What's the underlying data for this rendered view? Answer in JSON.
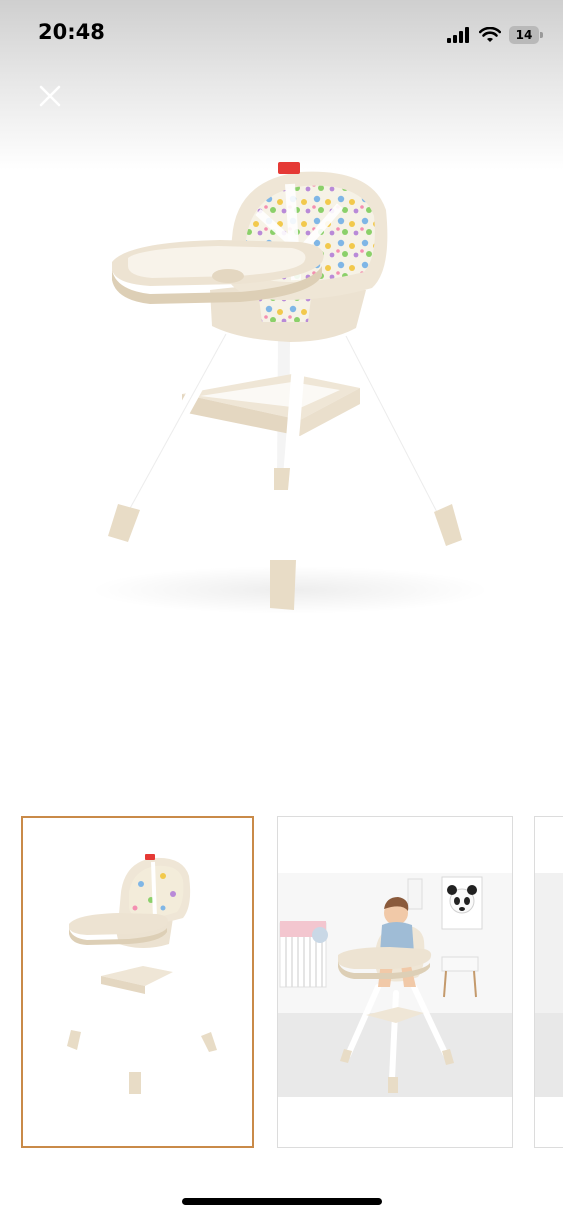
{
  "status_bar": {
    "time": "20:48",
    "battery_level": "14",
    "icons": [
      "cellular-signal-icon",
      "wifi-icon",
      "battery-charging-icon"
    ]
  },
  "viewer": {
    "close_icon": "close-icon",
    "main_image_alt": "",
    "thumbnails": [
      {
        "selected": true
      },
      {
        "selected": false
      },
      {
        "selected": false
      }
    ]
  },
  "colors": {
    "chair_cream": "#ece1cf",
    "leg_white": "#ffffff",
    "selected_border": "#c98a48"
  }
}
